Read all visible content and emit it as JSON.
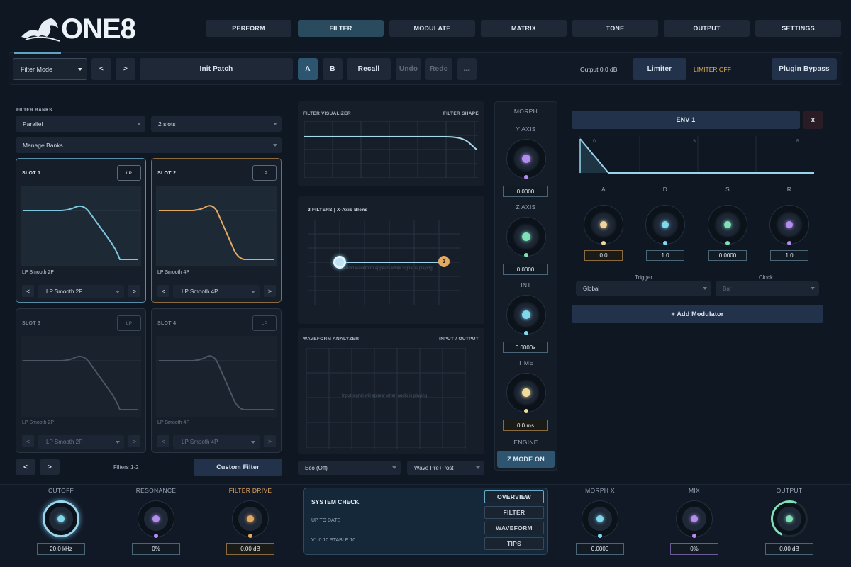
{
  "brand": {
    "name": "ONE8"
  },
  "tabs": [
    {
      "label": "PERFORM"
    },
    {
      "label": "FILTER"
    },
    {
      "label": "MODULATE"
    },
    {
      "label": "MATRIX"
    },
    {
      "label": "TONE"
    },
    {
      "label": "OUTPUT"
    },
    {
      "label": "SETTINGS"
    }
  ],
  "active_tab": "FILTER",
  "toolbar": {
    "mode": "Filter Mode",
    "prev": "<",
    "next": ">",
    "patch": "Init Patch",
    "a": "A",
    "b": "B",
    "recall": "Recall",
    "undo": "Undo",
    "redo": "Redo",
    "more": "...",
    "output_level": "Output 0.0 dB",
    "limiter": "Limiter",
    "limiter_status": "LIMITER OFF",
    "bypass": "Plugin Bypass"
  },
  "filter_banks": {
    "title": "FILTER BANKS",
    "routing": "Parallel",
    "slots_count": "2 slots",
    "manage": "Manage Banks",
    "slots": [
      {
        "title": "SLOT 1",
        "type": "LP",
        "name": "LP Smooth 2P",
        "select": "LP Smooth 2P"
      },
      {
        "title": "SLOT 2",
        "type": "LP",
        "name": "LP Smooth 4P",
        "select": "LP Smooth 4P"
      },
      {
        "title": "SLOT 3",
        "type": "LP",
        "name": "LP Smooth 2P",
        "select": "LP Smooth 2P"
      },
      {
        "title": "SLOT 4",
        "type": "LP",
        "name": "LP Smooth 4P",
        "select": "LP Smooth 4P"
      }
    ],
    "pager": "Filters 1-2",
    "custom": "Custom Filter"
  },
  "visualizer": {
    "title": "FILTER VISUALIZER",
    "right": "FILTER SHAPE"
  },
  "blend": {
    "title": "2 FILTERS | X-Axis Blend",
    "hint": "Audio waveform appears while signal is playing",
    "node_a": "1",
    "node_b": "2"
  },
  "waveform": {
    "title": "WAVEFORM ANALYZER",
    "right": "INPUT / OUTPUT",
    "hint": "Input signal will appear when audio is playing"
  },
  "quality": {
    "eco": "Eco (Off)",
    "wave": "Wave Pre+Post"
  },
  "morph": {
    "title": "MORPH",
    "knobs": [
      {
        "label": "Y AXIS",
        "value": "0.0000",
        "color": "#b48cf0"
      },
      {
        "label": "Z AXIS",
        "value": "0.0000",
        "color": "#7fe0b8"
      },
      {
        "label": "INT",
        "value": "0.0000x",
        "color": "#7fd8ee"
      },
      {
        "label": "TIME",
        "value": "0.0 ms",
        "color": "#f0dc9a"
      }
    ],
    "engine": "ENGINE",
    "zmode": "Z MODE ON"
  },
  "env": {
    "title": "ENV 1",
    "close": "x",
    "markers": [
      "D",
      "S",
      "R"
    ],
    "knobs": [
      {
        "label": "A",
        "value": "0.0",
        "color": "#f0d49a"
      },
      {
        "label": "D",
        "value": "1.0",
        "color": "#7fd8ee"
      },
      {
        "label": "S",
        "value": "0.0000",
        "color": "#7fe0b8"
      },
      {
        "label": "R",
        "value": "1.0",
        "color": "#b48cf0"
      }
    ],
    "trigger_label": "Trigger",
    "clock_label": "Clock",
    "trigger": "Global",
    "clock": "Bar",
    "add": "+ Add Modulator"
  },
  "bottom": {
    "cutoff": {
      "label": "CUTOFF",
      "value": "20.0 kHz"
    },
    "resonance": {
      "label": "RESONANCE",
      "value": "0%"
    },
    "drive": {
      "label": "FILTER DRIVE",
      "value": "0.00 dB"
    },
    "system": {
      "title": "SYSTEM CHECK",
      "status": "UP TO DATE",
      "version": "V1.0.10 STABLE 10",
      "buttons": [
        "OVERVIEW",
        "FILTER",
        "WAVEFORM",
        "TIPS"
      ]
    },
    "morphx": {
      "label": "MORPH X",
      "value": "0.0000"
    },
    "mix": {
      "label": "MIX",
      "value": "0%"
    },
    "output": {
      "label": "OUTPUT",
      "value": "0.00 dB"
    }
  },
  "colors": {
    "accent": "#7fd0ea",
    "amber": "#e5a860",
    "purple": "#b48cf0",
    "mint": "#7fe0b8",
    "limiter_warn": "#e0b35a"
  }
}
